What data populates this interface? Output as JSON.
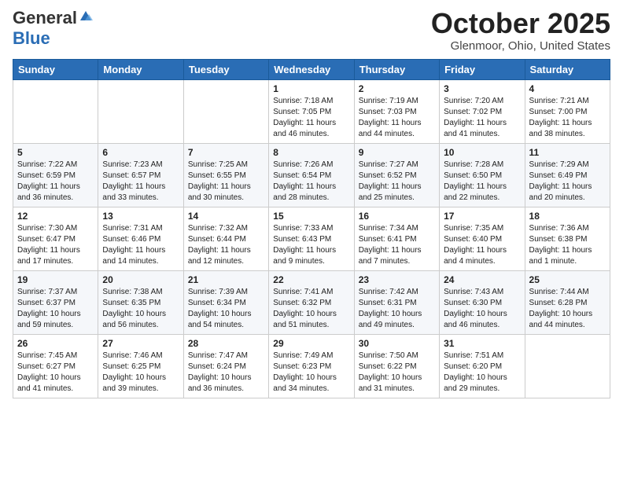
{
  "header": {
    "logo_general": "General",
    "logo_blue": "Blue",
    "month_title": "October 2025",
    "location": "Glenmoor, Ohio, United States"
  },
  "days_of_week": [
    "Sunday",
    "Monday",
    "Tuesday",
    "Wednesday",
    "Thursday",
    "Friday",
    "Saturday"
  ],
  "weeks": [
    [
      {
        "num": "",
        "info": ""
      },
      {
        "num": "",
        "info": ""
      },
      {
        "num": "",
        "info": ""
      },
      {
        "num": "1",
        "info": "Sunrise: 7:18 AM\nSunset: 7:05 PM\nDaylight: 11 hours and 46 minutes."
      },
      {
        "num": "2",
        "info": "Sunrise: 7:19 AM\nSunset: 7:03 PM\nDaylight: 11 hours and 44 minutes."
      },
      {
        "num": "3",
        "info": "Sunrise: 7:20 AM\nSunset: 7:02 PM\nDaylight: 11 hours and 41 minutes."
      },
      {
        "num": "4",
        "info": "Sunrise: 7:21 AM\nSunset: 7:00 PM\nDaylight: 11 hours and 38 minutes."
      }
    ],
    [
      {
        "num": "5",
        "info": "Sunrise: 7:22 AM\nSunset: 6:59 PM\nDaylight: 11 hours and 36 minutes."
      },
      {
        "num": "6",
        "info": "Sunrise: 7:23 AM\nSunset: 6:57 PM\nDaylight: 11 hours and 33 minutes."
      },
      {
        "num": "7",
        "info": "Sunrise: 7:25 AM\nSunset: 6:55 PM\nDaylight: 11 hours and 30 minutes."
      },
      {
        "num": "8",
        "info": "Sunrise: 7:26 AM\nSunset: 6:54 PM\nDaylight: 11 hours and 28 minutes."
      },
      {
        "num": "9",
        "info": "Sunrise: 7:27 AM\nSunset: 6:52 PM\nDaylight: 11 hours and 25 minutes."
      },
      {
        "num": "10",
        "info": "Sunrise: 7:28 AM\nSunset: 6:50 PM\nDaylight: 11 hours and 22 minutes."
      },
      {
        "num": "11",
        "info": "Sunrise: 7:29 AM\nSunset: 6:49 PM\nDaylight: 11 hours and 20 minutes."
      }
    ],
    [
      {
        "num": "12",
        "info": "Sunrise: 7:30 AM\nSunset: 6:47 PM\nDaylight: 11 hours and 17 minutes."
      },
      {
        "num": "13",
        "info": "Sunrise: 7:31 AM\nSunset: 6:46 PM\nDaylight: 11 hours and 14 minutes."
      },
      {
        "num": "14",
        "info": "Sunrise: 7:32 AM\nSunset: 6:44 PM\nDaylight: 11 hours and 12 minutes."
      },
      {
        "num": "15",
        "info": "Sunrise: 7:33 AM\nSunset: 6:43 PM\nDaylight: 11 hours and 9 minutes."
      },
      {
        "num": "16",
        "info": "Sunrise: 7:34 AM\nSunset: 6:41 PM\nDaylight: 11 hours and 7 minutes."
      },
      {
        "num": "17",
        "info": "Sunrise: 7:35 AM\nSunset: 6:40 PM\nDaylight: 11 hours and 4 minutes."
      },
      {
        "num": "18",
        "info": "Sunrise: 7:36 AM\nSunset: 6:38 PM\nDaylight: 11 hours and 1 minute."
      }
    ],
    [
      {
        "num": "19",
        "info": "Sunrise: 7:37 AM\nSunset: 6:37 PM\nDaylight: 10 hours and 59 minutes."
      },
      {
        "num": "20",
        "info": "Sunrise: 7:38 AM\nSunset: 6:35 PM\nDaylight: 10 hours and 56 minutes."
      },
      {
        "num": "21",
        "info": "Sunrise: 7:39 AM\nSunset: 6:34 PM\nDaylight: 10 hours and 54 minutes."
      },
      {
        "num": "22",
        "info": "Sunrise: 7:41 AM\nSunset: 6:32 PM\nDaylight: 10 hours and 51 minutes."
      },
      {
        "num": "23",
        "info": "Sunrise: 7:42 AM\nSunset: 6:31 PM\nDaylight: 10 hours and 49 minutes."
      },
      {
        "num": "24",
        "info": "Sunrise: 7:43 AM\nSunset: 6:30 PM\nDaylight: 10 hours and 46 minutes."
      },
      {
        "num": "25",
        "info": "Sunrise: 7:44 AM\nSunset: 6:28 PM\nDaylight: 10 hours and 44 minutes."
      }
    ],
    [
      {
        "num": "26",
        "info": "Sunrise: 7:45 AM\nSunset: 6:27 PM\nDaylight: 10 hours and 41 minutes."
      },
      {
        "num": "27",
        "info": "Sunrise: 7:46 AM\nSunset: 6:25 PM\nDaylight: 10 hours and 39 minutes."
      },
      {
        "num": "28",
        "info": "Sunrise: 7:47 AM\nSunset: 6:24 PM\nDaylight: 10 hours and 36 minutes."
      },
      {
        "num": "29",
        "info": "Sunrise: 7:49 AM\nSunset: 6:23 PM\nDaylight: 10 hours and 34 minutes."
      },
      {
        "num": "30",
        "info": "Sunrise: 7:50 AM\nSunset: 6:22 PM\nDaylight: 10 hours and 31 minutes."
      },
      {
        "num": "31",
        "info": "Sunrise: 7:51 AM\nSunset: 6:20 PM\nDaylight: 10 hours and 29 minutes."
      },
      {
        "num": "",
        "info": ""
      }
    ]
  ]
}
